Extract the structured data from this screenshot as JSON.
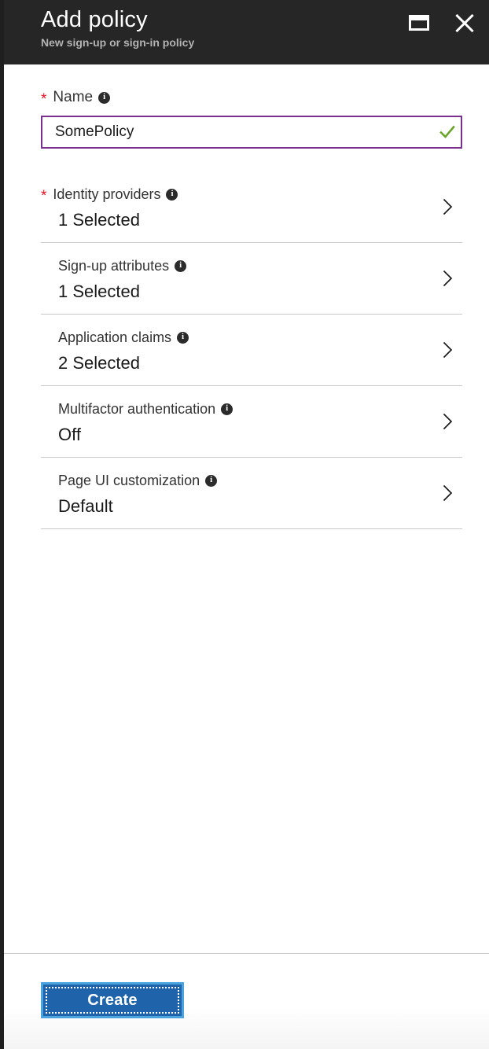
{
  "header": {
    "title": "Add policy",
    "subtitle": "New sign-up or sign-in policy",
    "maximize_icon": "maximize-icon",
    "close_icon": "close-icon"
  },
  "form": {
    "name_field": {
      "label": "Name",
      "required": true,
      "required_marker": "*",
      "info_icon": "info-icon",
      "value": "SomePolicy",
      "placeholder": "",
      "validation_icon": "checkmark-icon",
      "validation_color": "#6aa52b",
      "focus_border_color": "#7a2f8f"
    },
    "rows": [
      {
        "label": "Identity providers",
        "value": "1 Selected",
        "required": true,
        "required_marker": "*",
        "info_icon": "info-icon",
        "chevron_icon": "chevron-right-icon"
      },
      {
        "label": "Sign-up attributes",
        "value": "1 Selected",
        "required": false,
        "required_marker": "",
        "info_icon": "info-icon",
        "chevron_icon": "chevron-right-icon"
      },
      {
        "label": "Application claims",
        "value": "2 Selected",
        "required": false,
        "required_marker": "",
        "info_icon": "info-icon",
        "chevron_icon": "chevron-right-icon"
      },
      {
        "label": "Multifactor authentication",
        "value": "Off",
        "required": false,
        "required_marker": "",
        "info_icon": "info-icon",
        "chevron_icon": "chevron-right-icon"
      },
      {
        "label": "Page UI customization",
        "value": "Default",
        "required": false,
        "required_marker": "",
        "info_icon": "info-icon",
        "chevron_icon": "chevron-right-icon"
      }
    ]
  },
  "footer": {
    "create_label": "Create"
  },
  "colors": {
    "header_background": "#262626",
    "required_star": "#e81123",
    "primary_button": "#1f64ab",
    "primary_button_focus_ring": "#4aa3dd",
    "divider": "#c8c8c8"
  }
}
